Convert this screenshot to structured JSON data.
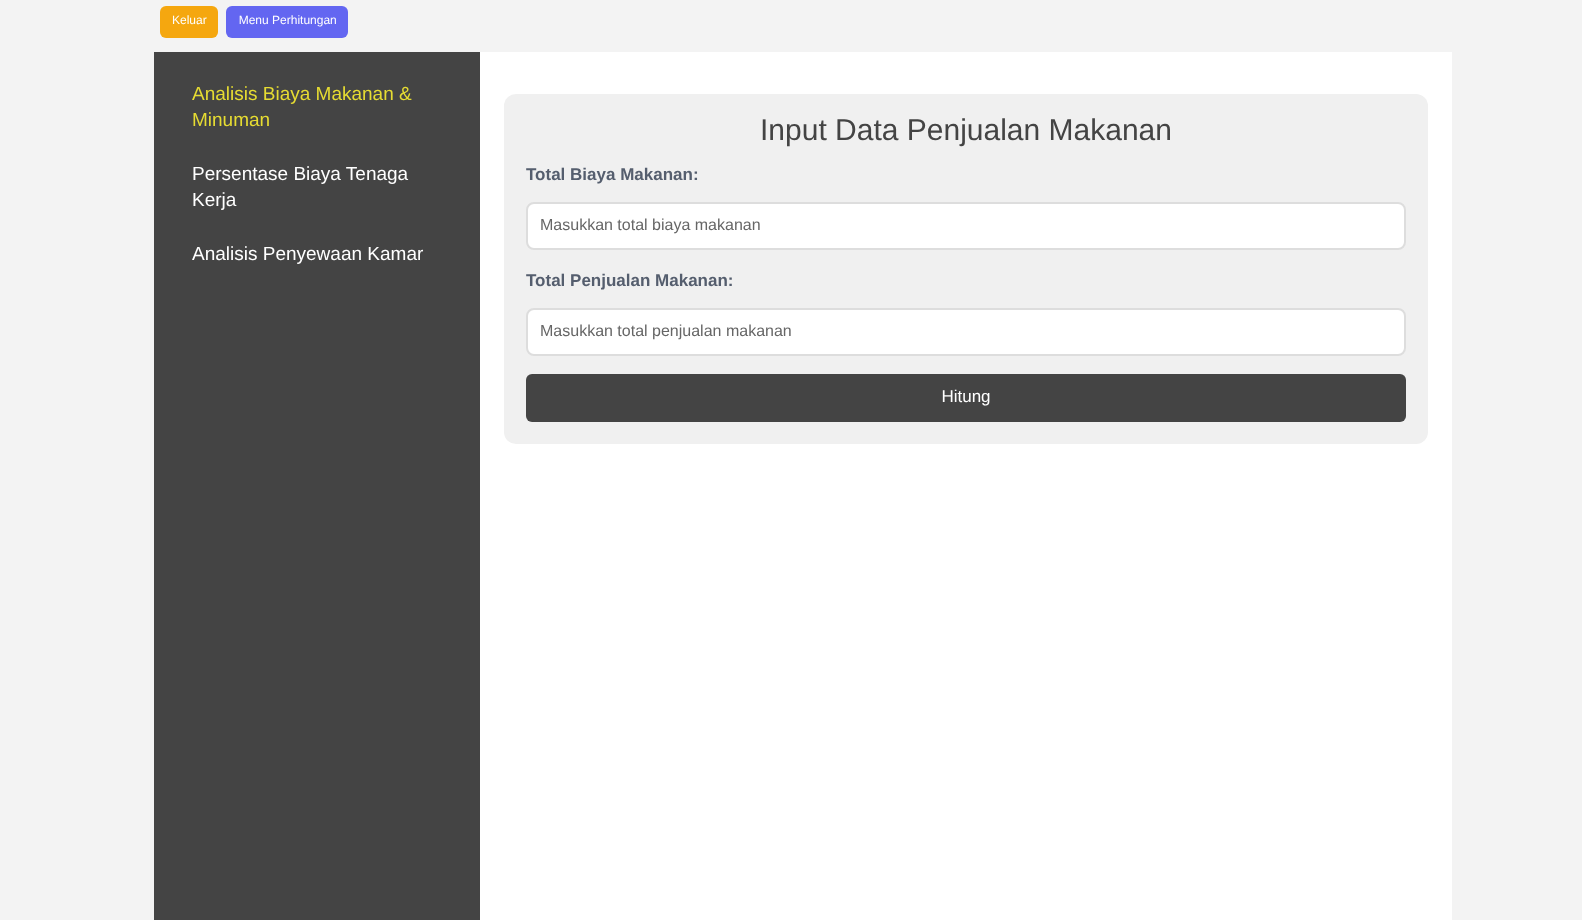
{
  "top_buttons": [
    {
      "label": "Keluar",
      "color": "#f5a70f"
    },
    {
      "label": "Menu Perhitungan",
      "color": "#6366f1"
    }
  ],
  "sidebar": {
    "items": [
      {
        "label": "Analisis Biaya Makanan & Minuman",
        "selected": true
      },
      {
        "label": "Persentase Biaya Tenaga Kerja",
        "selected": false
      },
      {
        "label": "Analisis Penyewaan Kamar",
        "selected": false
      }
    ]
  },
  "form": {
    "title": "Input Data Penjualan Makanan",
    "fields": [
      {
        "label": "Total Biaya Makanan:",
        "placeholder": "Masukkan total biaya makanan"
      },
      {
        "label": "Total Penjualan Makanan:",
        "placeholder": "Masukkan total penjualan makanan"
      }
    ],
    "submit": "Hitung"
  }
}
